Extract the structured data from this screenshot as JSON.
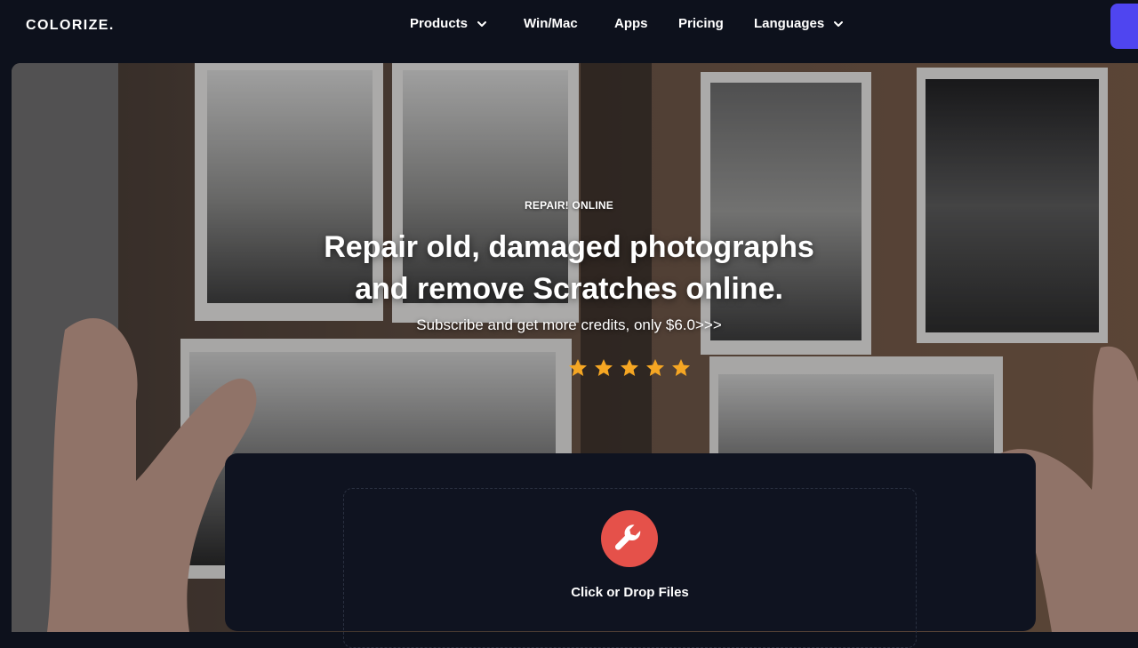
{
  "brand": {
    "logo": "COLORIZE."
  },
  "nav": {
    "items": [
      {
        "label": "Products",
        "has_dropdown": true
      },
      {
        "label": "Win/Mac",
        "has_dropdown": false
      },
      {
        "label": "Apps",
        "has_dropdown": false
      },
      {
        "label": "Pricing",
        "has_dropdown": false
      },
      {
        "label": "Languages",
        "has_dropdown": true
      }
    ],
    "chevron_icon": "chevron-down-icon",
    "cta_color": "#4f45f0"
  },
  "hero": {
    "eyebrow": "REPAIR! ONLINE",
    "headline_line1": "Repair old, damaged photographs",
    "headline_line2": "and remove Scratches online.",
    "subline": "Subscribe and get more credits, only $6.0>>>",
    "rating_stars": 5,
    "star_color": "#f5a623"
  },
  "upload": {
    "icon": "wrench-icon",
    "icon_color": "#e5514a",
    "label": "Click or Drop Files"
  }
}
